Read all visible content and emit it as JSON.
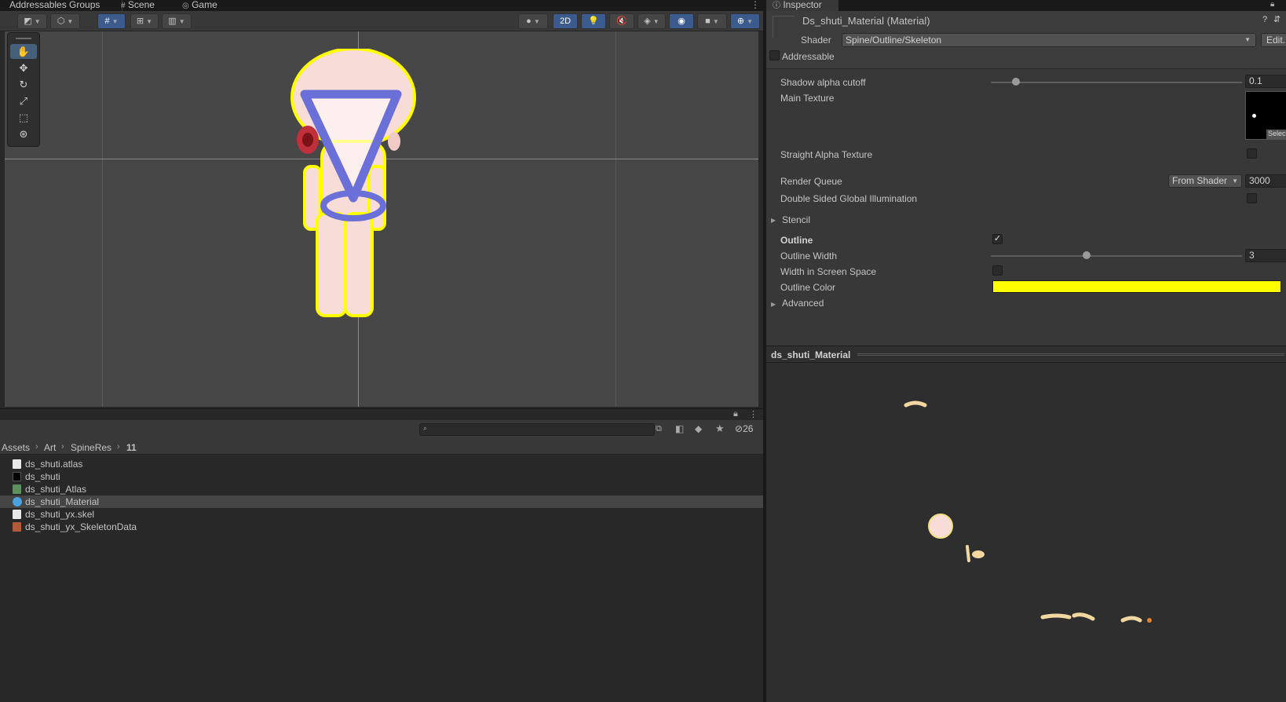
{
  "scene_window": {
    "tabs": [
      {
        "label": "Addressables Groups"
      },
      {
        "label": "Scene",
        "icon": "scene-icon"
      },
      {
        "label": "Game",
        "icon": "gamepad-icon"
      }
    ],
    "toolbar": {
      "mode_2d_label": "2D"
    },
    "tools": [
      "hand-tool",
      "move-tool",
      "rotate-tool",
      "scale-tool",
      "rect-tool",
      "transform-tool"
    ],
    "active_tool": "hand-tool"
  },
  "project_window": {
    "search_placeholder": "",
    "hidden_count": "26",
    "breadcrumb": [
      "Assets",
      "Art",
      "SpineRes",
      "11"
    ],
    "files": [
      {
        "name": "ds_shuti.atlas",
        "icon": "text-file-icon",
        "color": "#e8e8e8"
      },
      {
        "name": "ds_shuti",
        "icon": "black-texture-icon",
        "color": "#000000"
      },
      {
        "name": "ds_shuti_Atlas",
        "icon": "atlas-asset-icon",
        "color": "#5f8f5f"
      },
      {
        "name": "ds_shuti_Material",
        "icon": "material-sphere-icon",
        "color": "#4aa3df",
        "selected": true
      },
      {
        "name": "ds_shuti_yx.skel",
        "icon": "text-file-icon",
        "color": "#e8e8e8"
      },
      {
        "name": "ds_shuti_yx_SkeletonData",
        "icon": "skeleton-data-icon",
        "color": "#b05a3a"
      }
    ]
  },
  "inspector": {
    "tab_label": "Inspector",
    "title": "Ds_shuti_Material (Material)",
    "shader_label": "Shader",
    "shader_value": "Spine/Outline/Skeleton",
    "edit_label": "Edit...",
    "addressable_label": "Addressable",
    "properties": {
      "shadow_alpha_cutoff": {
        "label": "Shadow alpha cutoff",
        "value": "0.1",
        "fraction": 0.1
      },
      "main_texture": {
        "label": "Main Texture",
        "select_label": "Select"
      },
      "straight_alpha": {
        "label": "Straight Alpha Texture",
        "checked": false
      },
      "render_queue": {
        "label": "Render Queue",
        "mode": "From Shader",
        "value": "3000"
      },
      "double_sided_gi": {
        "label": "Double Sided Global Illumination",
        "checked": false
      },
      "stencil": {
        "label": "Stencil"
      },
      "outline": {
        "label": "Outline",
        "checked": true
      },
      "outline_width": {
        "label": "Outline Width",
        "value": "3",
        "fraction": 0.38
      },
      "width_in_screen_space": {
        "label": "Width in Screen Space",
        "checked": false
      },
      "outline_color": {
        "label": "Outline Color",
        "color": "#ffff00"
      },
      "advanced": {
        "label": "Advanced"
      }
    },
    "preview_title": "ds_shuti_Material"
  }
}
